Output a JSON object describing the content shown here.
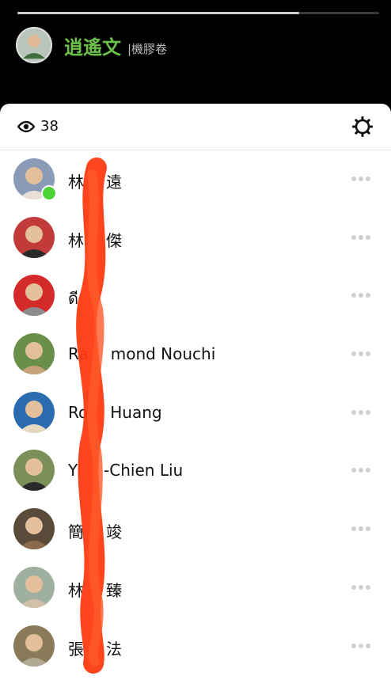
{
  "story": {
    "progress": 0.78,
    "user_name": "逍遙文",
    "subtitle": "|機膠卷"
  },
  "sheet": {
    "view_count": "38",
    "icons": {
      "views": "eye-icon",
      "settings": "gear-icon",
      "more": "more-horizontal-icon"
    },
    "viewers": [
      {
        "name": "林",
        "name_after": "遠",
        "online": true,
        "avatar_colors": [
          "#8a9bb8",
          "#e8e0d8"
        ]
      },
      {
        "name": "林",
        "name_after": "傑",
        "online": false,
        "avatar_colors": [
          "#c23b3b",
          "#2a2a2a"
        ]
      },
      {
        "name": "ดี",
        "name_after": "",
        "online": false,
        "avatar_colors": [
          "#d42a2a",
          "#8d8d8d"
        ]
      },
      {
        "name": "Ra",
        "name_after": "mond Nouchi",
        "online": false,
        "avatar_colors": [
          "#6a8f4a",
          "#c8a27a"
        ]
      },
      {
        "name": "Ro",
        "name_after": "Huang",
        "online": false,
        "avatar_colors": [
          "#2b6cb0",
          "#e8d8c0"
        ]
      },
      {
        "name": "Yi",
        "name_after": "-Chien Liu",
        "online": false,
        "avatar_colors": [
          "#7a8f5a",
          "#2a2a2a"
        ]
      },
      {
        "name": "簡",
        "name_after": "竣",
        "online": false,
        "avatar_colors": [
          "#5a4a3a",
          "#8a6a4a"
        ]
      },
      {
        "name": "林",
        "name_after": "臻",
        "online": false,
        "avatar_colors": [
          "#a0b0a0",
          "#d0c0a8"
        ]
      },
      {
        "name": "張",
        "name_after": "法",
        "online": false,
        "avatar_colors": [
          "#8a7a5a",
          "#b0a890"
        ]
      }
    ]
  },
  "colors": {
    "accent_green": "#6cc04a",
    "online": "#4cd137",
    "redaction": "#ff3b12"
  }
}
